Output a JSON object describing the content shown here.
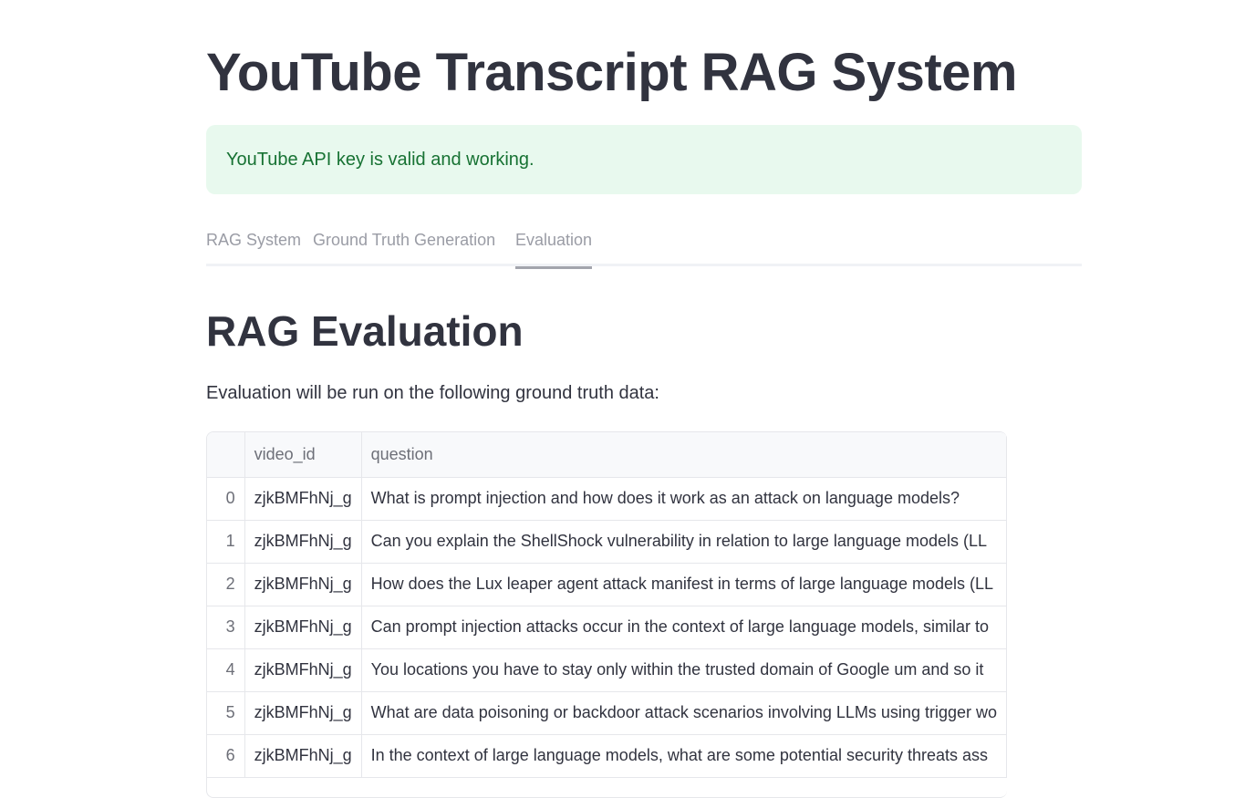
{
  "page": {
    "title": "YouTube Transcript RAG System"
  },
  "alert": {
    "message": "YouTube API key is valid and working."
  },
  "tabs": [
    {
      "label": "RAG System",
      "active": false
    },
    {
      "label": "Ground Truth Generation",
      "active": false
    },
    {
      "label": "Evaluation",
      "active": true
    }
  ],
  "evaluation": {
    "heading": "RAG Evaluation",
    "description": "Evaluation will be run on the following ground truth data:"
  },
  "table": {
    "columns": [
      "",
      "video_id",
      "question"
    ],
    "rows": [
      {
        "index": "0",
        "video_id": "zjkBMFhNj_g",
        "question": "What is prompt injection and how does it work as an attack on language models?"
      },
      {
        "index": "1",
        "video_id": "zjkBMFhNj_g",
        "question": "Can you explain the ShellShock vulnerability in relation to large language models (LL"
      },
      {
        "index": "2",
        "video_id": "zjkBMFhNj_g",
        "question": "How does the Lux leaper agent attack manifest in terms of large language models (LL"
      },
      {
        "index": "3",
        "video_id": "zjkBMFhNj_g",
        "question": "Can prompt injection attacks occur in the context of large language models, similar to"
      },
      {
        "index": "4",
        "video_id": "zjkBMFhNj_g",
        "question": "You locations you have to stay only within the trusted domain of Google um and so it"
      },
      {
        "index": "5",
        "video_id": "zjkBMFhNj_g",
        "question": "What are data poisoning or backdoor attack scenarios involving LLMs using trigger wo"
      },
      {
        "index": "6",
        "video_id": "zjkBMFhNj_g",
        "question": "In the context of large language models, what are some potential security threats ass"
      }
    ]
  }
}
